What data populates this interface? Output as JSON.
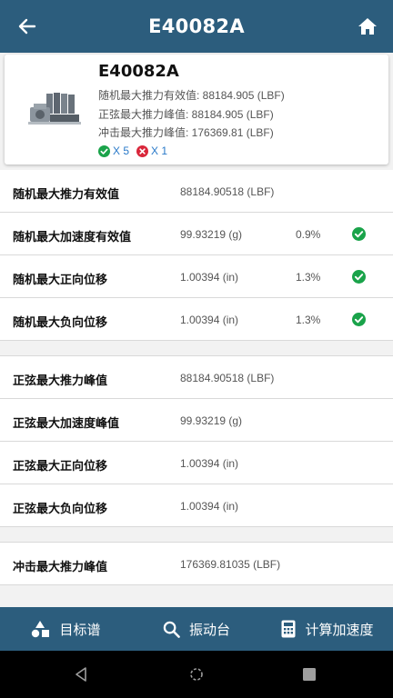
{
  "header": {
    "title": "E40082A"
  },
  "card": {
    "name": "E40082A",
    "random_thrust": "随机最大推力有效值: 88184.905 (LBF)",
    "sine_thrust": "正弦最大推力峰值: 88184.905 (LBF)",
    "shock_thrust": "冲击最大推力峰值: 176369.81 (LBF)",
    "pass_count": "X 5",
    "fail_count": "X 1"
  },
  "rows": [
    {
      "label": "随机最大推力有效值",
      "value": "88184.90518 (LBF)",
      "pct": ""
    },
    {
      "label": "随机最大加速度有效值",
      "value": "99.93219 (g)",
      "pct": "0.9%"
    },
    {
      "label": "随机最大正向位移",
      "value": "1.00394 (in)",
      "pct": "1.3%"
    },
    {
      "label": "随机最大负向位移",
      "value": "1.00394 (in)",
      "pct": "1.3%"
    },
    {
      "label": "正弦最大推力峰值",
      "value": "88184.90518 (LBF)",
      "pct": ""
    },
    {
      "label": "正弦最大加速度峰值",
      "value": "99.93219 (g)",
      "pct": ""
    },
    {
      "label": "正弦最大正向位移",
      "value": "1.00394 (in)",
      "pct": ""
    },
    {
      "label": "正弦最大负向位移",
      "value": "1.00394 (in)",
      "pct": ""
    },
    {
      "label": "冲击最大推力峰值",
      "value": "176369.81035 (LBF)",
      "pct": ""
    }
  ],
  "bottom_nav": {
    "target_spectrum": "目标谱",
    "shaker": "振动台",
    "calc_accel": "计算加速度"
  },
  "colors": {
    "primary": "#2c5d7d",
    "pass": "#1aa34a",
    "fail": "#d9263a",
    "count": "#2979c9"
  },
  "icons": [
    "back-arrow-icon",
    "home-icon",
    "check-circle-icon",
    "x-circle-icon",
    "shapes-icon",
    "search-icon",
    "calculator-icon",
    "nav-back-icon",
    "nav-home-icon",
    "nav-recents-icon"
  ]
}
